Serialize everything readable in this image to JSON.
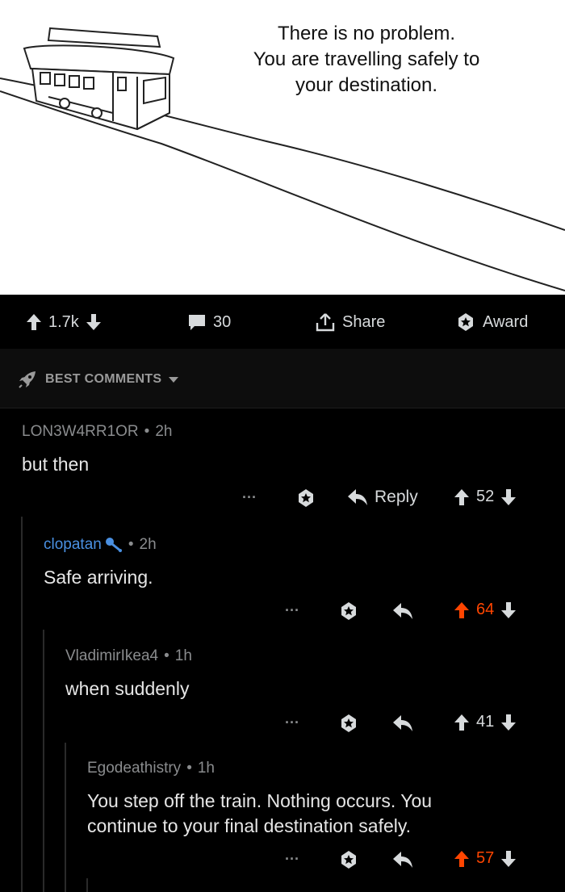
{
  "meme": {
    "caption_lines": [
      "There is no problem.",
      "You are travelling safely to",
      "your destination."
    ]
  },
  "post_actions": {
    "score": "1.7k",
    "comments": "30",
    "share_label": "Share",
    "award_label": "Award"
  },
  "sort": {
    "label": "BEST COMMENTS"
  },
  "comments": [
    {
      "author": "LON3W4RR1OR",
      "age": "2h",
      "body": "but then",
      "reply_label": "Reply",
      "score": "52",
      "upvoted": false
    },
    {
      "author": "clopatan",
      "age": "2h",
      "body": "Safe arriving.",
      "score": "64",
      "upvoted": true
    },
    {
      "author": "VladimirIkea4",
      "age": "1h",
      "body": "when suddenly",
      "score": "41",
      "upvoted": false
    },
    {
      "author": "Egodeathistry",
      "age": "1h",
      "body_lines": [
        "You step off the train. Nothing occurs. You",
        "continue to your final destination safely."
      ],
      "score": "57",
      "upvoted": true
    }
  ],
  "meta_sep": "•",
  "more_dots": "···",
  "colors": {
    "accent_orange": "#ff4500",
    "author_blue": "#4a90e2",
    "background": "#000000"
  }
}
